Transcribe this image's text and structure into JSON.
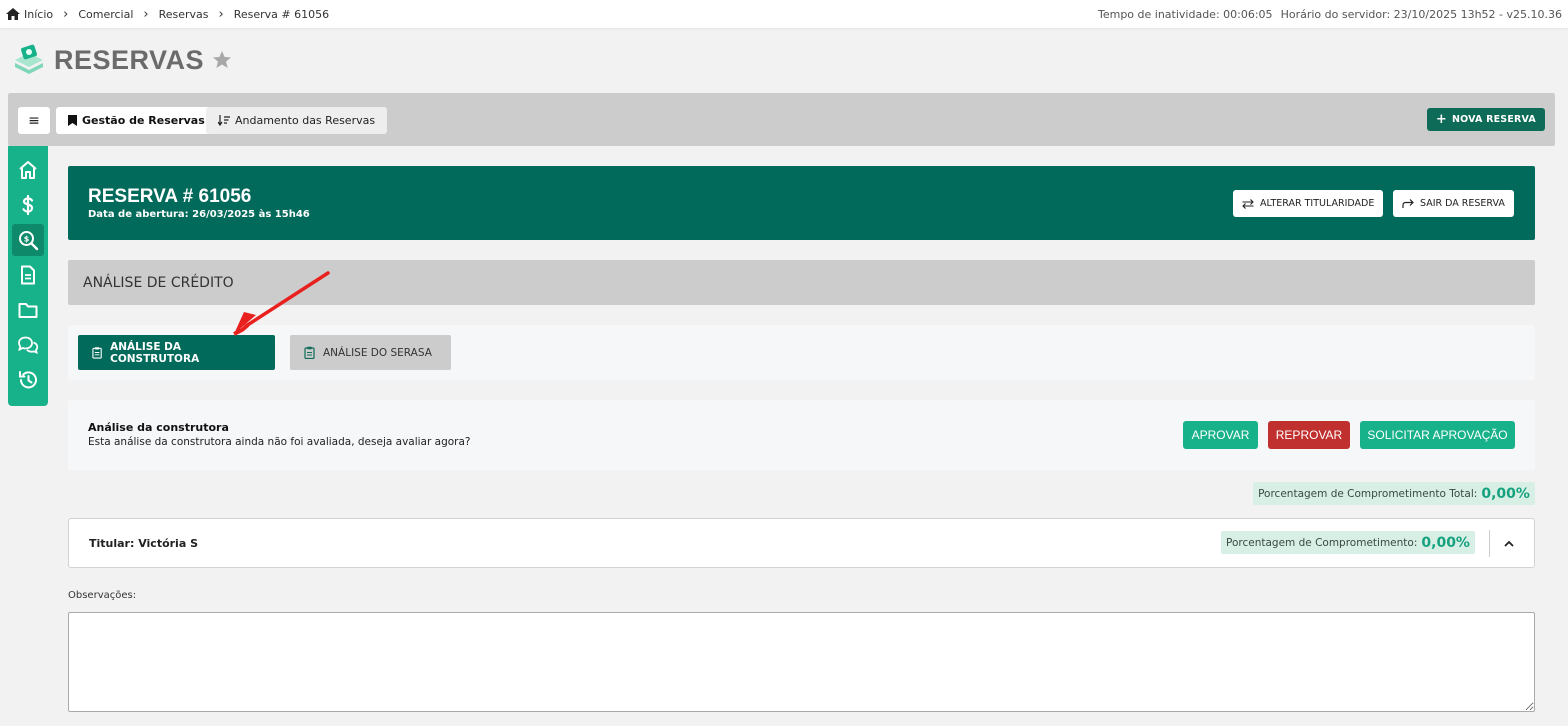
{
  "breadcrumb": {
    "items": [
      "Início",
      "Comercial",
      "Reservas",
      "Reserva # 61056"
    ]
  },
  "server": {
    "inactivity": "Tempo de inatividade: 00:06:05",
    "server_time": "Horário do servidor: 23/10/2025 13h52 - v25.10.36"
  },
  "header": {
    "title": "RESERVAS"
  },
  "toolbar": {
    "menu_glyph": "≡",
    "tab_gestao": "Gestão de Reservas",
    "tab_andamento": "Andamento das Reservas",
    "nova_reserva": "NOVA RESERVA"
  },
  "reserva": {
    "title": "RESERVA # 61056",
    "opened": "Data de abertura: 26/03/2025 às 15h46",
    "btn_alterar": "ALTERAR TITULARIDADE",
    "btn_sair": "SAIR DA RESERVA"
  },
  "section": {
    "title": "ANÁLISE DE CRÉDITO"
  },
  "analysis_tabs": {
    "construtora": "ANÁLISE DA CONSTRUTORA",
    "serasa": "ANÁLISE DO SERASA"
  },
  "evaluation": {
    "title": "Análise da construtora",
    "message": "Esta análise da construtora ainda não foi avaliada, deseja avaliar agora?",
    "approve": "APROVAR",
    "reject": "REPROVAR",
    "request": "SOLICITAR APROVAÇÃO"
  },
  "total_commitment": {
    "label": "Porcentagem de Comprometimento Total:",
    "value": "0,00%"
  },
  "titular": {
    "label": "Titular: Victória S",
    "commitment_label": "Porcentagem de Comprometimento:",
    "commitment_value": "0,00%"
  },
  "observations": {
    "label": "Observações:",
    "value": ""
  },
  "colors": {
    "brand_dark": "#026a5a",
    "brand_green": "#17b18a",
    "danger": "#c0302f",
    "commitment_bg": "#d8efe6"
  },
  "icons": {
    "sidebar": [
      "home-icon",
      "dollar-icon",
      "search-money-icon",
      "document-icon",
      "folder-icon",
      "chat-icon",
      "history-icon"
    ]
  }
}
